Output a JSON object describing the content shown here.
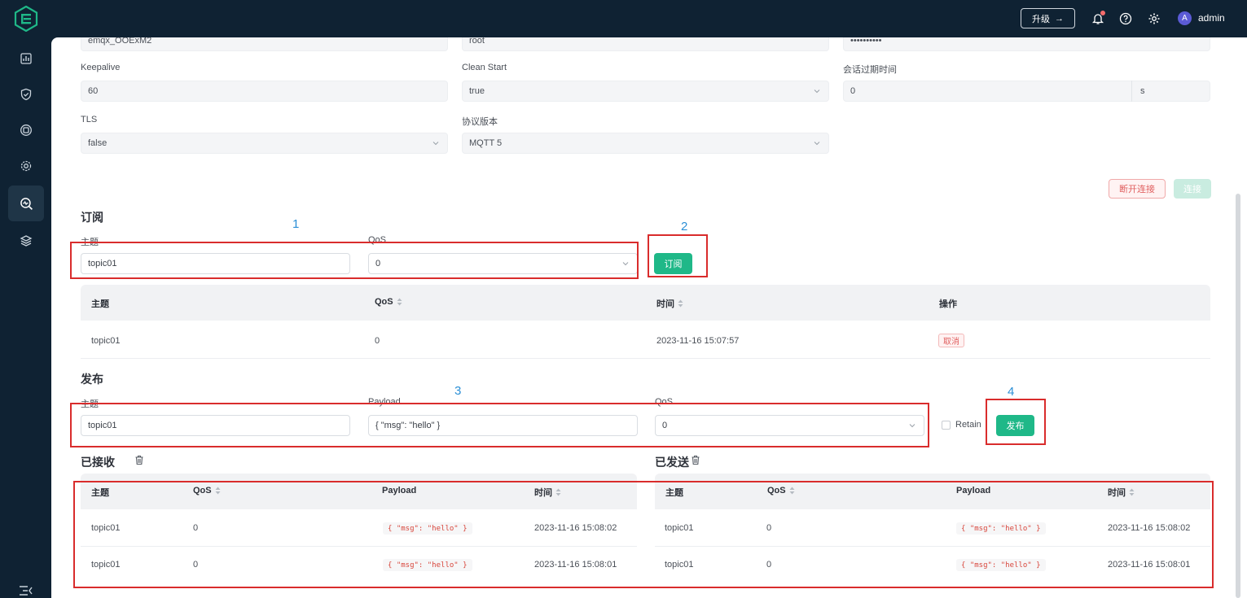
{
  "colors": {
    "accent": "#1fb888",
    "annotation_box": "#d92c2c",
    "annotation_number": "#2b8fd6",
    "sidebar_bg": "#0f2233"
  },
  "topbar": {
    "upgrade_label": "升级",
    "upgrade_arrow": "→",
    "username": "admin",
    "avatar_initial": "A",
    "icons": [
      "bell-icon",
      "help-icon",
      "settings-icon"
    ]
  },
  "sidebar": {
    "items": [
      "dashboard-icon",
      "shield-icon",
      "cluster-icon",
      "settings-gear-icon",
      "diagnose-search-icon",
      "layers-icon"
    ],
    "active_index": 4
  },
  "connection": {
    "top_values": [
      "emqx_OOExM2",
      "root",
      "••••••••••"
    ],
    "keepalive_label": "Keepalive",
    "keepalive_value": "60",
    "clean_start_label": "Clean Start",
    "clean_start_value": "true",
    "session_expiry_label": "会话过期时间",
    "session_expiry_value": "0",
    "session_expiry_unit": "s",
    "tls_label": "TLS",
    "tls_value": "false",
    "protocol_label": "协议版本",
    "protocol_value": "MQTT 5",
    "disconnect_label": "断开连接",
    "connect_label": "连接"
  },
  "subscribe": {
    "title": "订阅",
    "topic_label": "主题",
    "topic_value": "topic01",
    "qos_label": "QoS",
    "qos_value": "0",
    "button_label": "订阅",
    "table": {
      "headers": [
        "主题",
        "QoS",
        "时间",
        "操作"
      ],
      "rows": [
        {
          "topic": "topic01",
          "qos": "0",
          "time": "2023-11-16 15:07:57",
          "action": "取消"
        }
      ]
    }
  },
  "publish": {
    "title": "发布",
    "topic_label": "主题",
    "topic_value": "topic01",
    "payload_label": "Payload",
    "payload_value": "{ \"msg\": \"hello\" }",
    "qos_label": "QoS",
    "qos_value": "0",
    "retain_label": "Retain",
    "button_label": "发布"
  },
  "received": {
    "title": "已接收",
    "headers": [
      "主题",
      "QoS",
      "Payload",
      "时间"
    ],
    "rows": [
      {
        "topic": "topic01",
        "qos": "0",
        "payload": "{ \"msg\": \"hello\" }",
        "time": "2023-11-16 15:08:02"
      },
      {
        "topic": "topic01",
        "qos": "0",
        "payload": "{ \"msg\": \"hello\" }",
        "time": "2023-11-16 15:08:01"
      }
    ]
  },
  "sent": {
    "title": "已发送",
    "headers": [
      "主题",
      "QoS",
      "Payload",
      "时间"
    ],
    "rows": [
      {
        "topic": "topic01",
        "qos": "0",
        "payload": "{ \"msg\": \"hello\" }",
        "time": "2023-11-16 15:08:02"
      },
      {
        "topic": "topic01",
        "qos": "0",
        "payload": "{ \"msg\": \"hello\" }",
        "time": "2023-11-16 15:08:01"
      }
    ]
  },
  "annotations": [
    "1",
    "2",
    "3",
    "4"
  ]
}
